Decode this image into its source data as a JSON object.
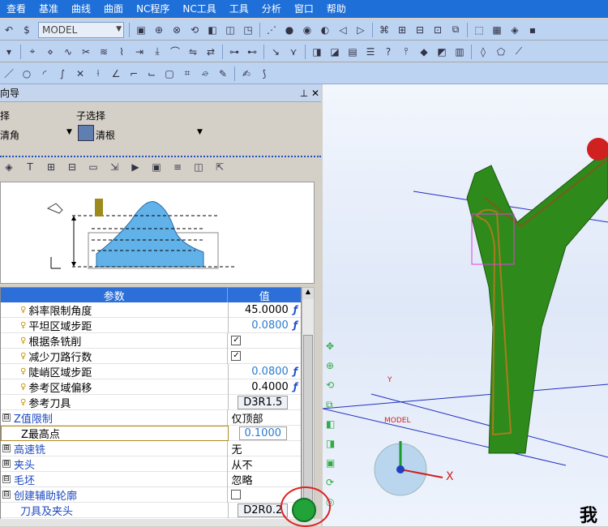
{
  "menubar": [
    "查看",
    "基准",
    "曲线",
    "曲面",
    "NC程序",
    "NC工具",
    "工具",
    "分析",
    "窗口",
    "帮助"
  ],
  "toolbar": {
    "model_combo": "MODEL"
  },
  "panel": {
    "title": "向导",
    "select_label": "择",
    "subselect_label": "子选择",
    "select_value": "清角",
    "subselect_value": "清根"
  },
  "grid": {
    "header_param": "参数",
    "header_value": "值",
    "rows": [
      {
        "name": "斜率限制角度",
        "value": "45.0000",
        "fx": "ƒ",
        "type": "text"
      },
      {
        "name": "平坦区域步距",
        "value": "0.0800",
        "fx": "ƒ",
        "type": "blue"
      },
      {
        "name": "根据条铣削",
        "value": "✓",
        "type": "check"
      },
      {
        "name": "减少刀路行数",
        "value": "✓",
        "type": "check"
      },
      {
        "name": "陡峭区域步距",
        "value": "0.0800",
        "fx": "ƒ",
        "type": "blue"
      },
      {
        "name": "参考区域偏移",
        "value": "0.4000",
        "fx": "ƒ",
        "type": "text"
      },
      {
        "name": "参考刀具",
        "value": "D3R1.5",
        "type": "box"
      }
    ],
    "groups": [
      {
        "name": "Z值限制",
        "value": "仅顶部",
        "sign": "⊟"
      },
      {
        "name": "Z最高点",
        "value": "0.1000",
        "sign": "",
        "type": "box"
      },
      {
        "name": "高速铣",
        "value": "无",
        "sign": "⊞"
      },
      {
        "name": "夹头",
        "value": "从不",
        "sign": "⊞"
      },
      {
        "name": "毛坯",
        "value": "忽略",
        "sign": "⊟"
      },
      {
        "name": "创建辅助轮廓",
        "value": "",
        "sign": "⊟"
      },
      {
        "name": "刀具及夹头",
        "value": "D2R0.2",
        "sign": ""
      }
    ]
  },
  "view": {
    "axis_x": "X",
    "axis_y": "Y",
    "model_label": "MODEL",
    "corner_text": "我"
  },
  "colors": {
    "menubar": "#1e6fd8",
    "accent": "#2c6fd8",
    "part_green": "#2f8a1c",
    "ok_green": "#22a33a"
  }
}
